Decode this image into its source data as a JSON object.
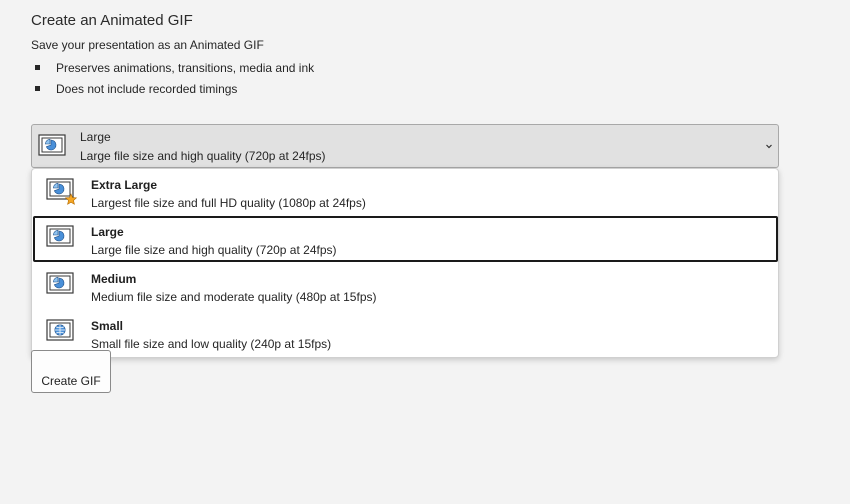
{
  "header": {
    "title": "Create an Animated GIF",
    "subtitle": "Save your presentation as an Animated GIF"
  },
  "bullets": [
    "Preserves animations, transitions, media and ink",
    "Does not include recorded timings"
  ],
  "select": {
    "current_name": "Large",
    "current_desc": "Large file size and high quality (720p at 24fps)",
    "icon": "slide-icon"
  },
  "options": [
    {
      "name": "Extra Large",
      "desc": "Largest file size and full HD quality (1080p at 24fps)",
      "icon": "slide-star-icon"
    },
    {
      "name": "Large",
      "desc": "Large file size and high quality (720p at 24fps)",
      "icon": "slide-icon",
      "selected": true
    },
    {
      "name": "Medium",
      "desc": "Medium file size and moderate quality (480p at 15fps)",
      "icon": "slide-icon"
    },
    {
      "name": "Small",
      "desc": "Small file size and low quality (240p at 15fps)",
      "icon": "slide-globe-icon"
    }
  ],
  "button": {
    "label": "Create GIF"
  },
  "colors": {
    "background": "#f3f3f3",
    "select_bg": "#e1e1e1",
    "dropdown_bg": "#ffffff",
    "icon_blue": "#4a90d9",
    "star": "#f5a623"
  }
}
